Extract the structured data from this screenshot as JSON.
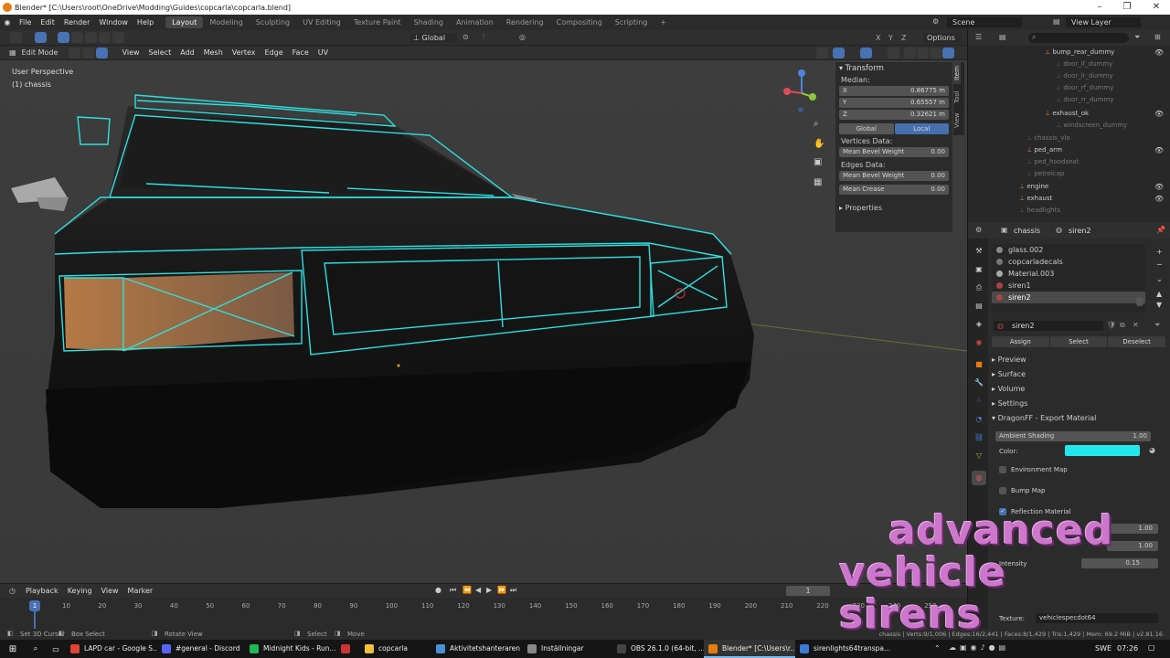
{
  "window": {
    "title": "Blender* [C:\\Users\\root\\OneDrive\\Modding\\Guides\\copcarla\\copcarla.blend]"
  },
  "menus": [
    "File",
    "Edit",
    "Render",
    "Window",
    "Help"
  ],
  "workspaces": [
    "Layout",
    "Modeling",
    "Sculpting",
    "UV Editing",
    "Texture Paint",
    "Shading",
    "Animation",
    "Rendering",
    "Compositing",
    "Scripting"
  ],
  "scene": {
    "name": "Scene",
    "view_layer": "View Layer"
  },
  "tool_header": {
    "orientation": "Global",
    "options": "Options"
  },
  "view_header": {
    "mode": "Edit Mode",
    "menus": [
      "View",
      "Select",
      "Add",
      "Mesh",
      "Vertex",
      "Edge",
      "Face",
      "UV"
    ]
  },
  "viewport": {
    "perspective": "User Perspective",
    "object": "(1) chassis"
  },
  "npanel": {
    "tabs": [
      "Item",
      "Tool",
      "View"
    ],
    "transform_title": "Transform",
    "median": "Median:",
    "x_label": "X",
    "x": "0.86775 m",
    "y_label": "Y",
    "y": "0.65557 m",
    "z_label": "Z",
    "z": "0.32621 m",
    "global": "Global",
    "local": "Local",
    "vertices_data": "Vertices Data:",
    "mean_bevel_weight_label": "Mean Bevel Weight",
    "mean_bevel_weight_v": "0.00",
    "edges_data": "Edges Data:",
    "mean_bevel_weight_e": "0.00",
    "mean_crease_label": "Mean Crease",
    "mean_crease": "0.00",
    "properties": "Properties"
  },
  "outliner": {
    "items": [
      {
        "name": "bump_rear_dummy",
        "dim": false
      },
      {
        "name": "door_lf_dummy",
        "dim": true
      },
      {
        "name": "door_lr_dummy",
        "dim": true
      },
      {
        "name": "door_rf_dummy",
        "dim": true
      },
      {
        "name": "door_rr_dummy",
        "dim": true
      },
      {
        "name": "exhaust_ok",
        "dim": false
      },
      {
        "name": "windscreen_dummy",
        "dim": true
      },
      {
        "name": "chassis_vlo",
        "dim": true
      },
      {
        "name": "ped_arm",
        "dim": false
      },
      {
        "name": "ped_hoodseat",
        "dim": true
      },
      {
        "name": "petrolcap",
        "dim": true
      },
      {
        "name": "engine",
        "dim": false
      },
      {
        "name": "exhaust",
        "dim": false
      },
      {
        "name": "headlights",
        "dim": true
      }
    ]
  },
  "properties": {
    "object": "chassis",
    "material": "siren2",
    "slots": [
      "glass.002",
      "copcarladecals",
      "Material.003",
      "siren1",
      "siren2"
    ],
    "mat_field": "siren2",
    "assign": "Assign",
    "select": "Select",
    "deselect": "Deselect",
    "sections": [
      "Preview",
      "Surface",
      "Volume",
      "Settings"
    ],
    "dragonff": "DragonFF - Export Material",
    "ambient_label": "Ambient Shading",
    "ambient": "1.00",
    "color_label": "Color:",
    "env_map": "Environment Map",
    "bump_map": "Bump Map",
    "reflection": "Reflection Material",
    "refl_v1": "1.00",
    "refl_v2": "1.00",
    "intensity_label": "Intensity",
    "intensity": "0.15",
    "texture_label": "Texture:",
    "texture": "vehiclespecdot64"
  },
  "timeline": {
    "menus": [
      "Playback",
      "Keying",
      "View",
      "Marker"
    ],
    "current_frame": "1",
    "frame_marker": "1",
    "ticks": [
      "10",
      "20",
      "30",
      "40",
      "50",
      "60",
      "70",
      "80",
      "90",
      "100",
      "110",
      "120",
      "130",
      "140",
      "150",
      "160",
      "170",
      "180",
      "190",
      "200",
      "210",
      "220",
      "230",
      "240",
      "250"
    ]
  },
  "statusbar": {
    "a": "Set 3D Cursor",
    "b": "Box Select",
    "c": "Rotate View",
    "d": "Select",
    "e": "Move",
    "stats": "chassis | Verts:9/1,006 | Edges:16/2,441 | Faces:8/1,429 | Tris:1,429 | Mem: 69.2 MiB | v2.81.16"
  },
  "taskbar": {
    "items": [
      {
        "label": "LAPD car - Google S...",
        "color": "#dd4433"
      },
      {
        "label": "#general - Discord",
        "color": "#5865f2"
      },
      {
        "label": "Midnight Kids - Run...",
        "color": "#1db954"
      },
      {
        "label": "",
        "color": "#cc3333"
      },
      {
        "label": "copcarla",
        "color": "#f0c040"
      },
      {
        "label": "Aktivitetshanteraren",
        "color": "#4a90d9"
      },
      {
        "label": "Inställningar",
        "color": "#888888"
      },
      {
        "label": "OBS 26.1.0 (64-bit, ...",
        "color": "#444444"
      },
      {
        "label": "Blender* [C:\\Users\\r...",
        "color": "#e87d0d"
      },
      {
        "label": "sirenlights64transpa...",
        "color": "#3a7bd5"
      }
    ],
    "lang": "SWE",
    "time": "07:26"
  },
  "watermark": {
    "line1": "advanced",
    "line2": "vehicle sirens"
  },
  "colors": {
    "accent": "#4772b3",
    "siren": "#22e8ec",
    "wire": "#2ee0e0",
    "watermark": "#cc77cc"
  }
}
